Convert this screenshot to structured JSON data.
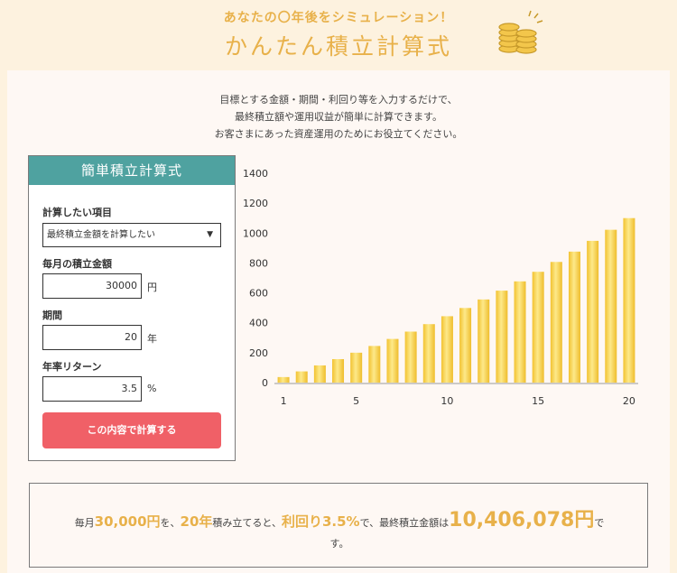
{
  "header": {
    "subtitle": "あなたの〇年後をシミュレーション！",
    "title": "かんたん積立計算式",
    "icon": "coins-icon"
  },
  "intro": {
    "line1": "目標とする金額・期間・利回り等を入力するだけで、",
    "line2": "最終積立額や運用収益が簡単に計算できます。",
    "line3": "お客さまにあった資産運用のためにお役立てください。"
  },
  "calculator": {
    "title": "簡単積立計算式",
    "item_label": "計算したい項目",
    "item_value": "最終積立金額を計算したい",
    "monthly_label": "毎月の積立金額",
    "monthly_value": "30000",
    "monthly_unit": "円",
    "period_label": "期間",
    "period_value": "20",
    "period_unit": "年",
    "return_label": "年率リターン",
    "return_value": "3.5",
    "return_unit": "%",
    "button_label": "この内容で計算する"
  },
  "result": {
    "p1": "毎月",
    "monthly": "30,000円",
    "p2": "を、",
    "years": "20年",
    "p3": "積み立てると、",
    "rate": "利回り3.5%",
    "p4": "で、最終積立金額は",
    "total": "10,406,078円",
    "p5": "で",
    "p6": "す。"
  },
  "colors": {
    "accent": "#e8b14a",
    "teal": "#4fa2a0",
    "button": "#f06067"
  },
  "chart_data": {
    "type": "bar",
    "x": [
      1,
      2,
      3,
      4,
      5,
      6,
      7,
      8,
      9,
      10,
      11,
      12,
      13,
      14,
      15,
      16,
      17,
      18,
      19,
      20
    ],
    "values": [
      37,
      75,
      115,
      157,
      200,
      245,
      292,
      341,
      391,
      444,
      499,
      556,
      615,
      677,
      741,
      807,
      876,
      948,
      1022,
      1100
    ],
    "x_ticks": [
      1,
      5,
      10,
      15,
      20
    ],
    "y_ticks": [
      0,
      200,
      400,
      600,
      800,
      1000,
      1200,
      1400
    ],
    "ylim": [
      0,
      1400
    ],
    "bar_color": "#f6cf47",
    "grid": false
  }
}
